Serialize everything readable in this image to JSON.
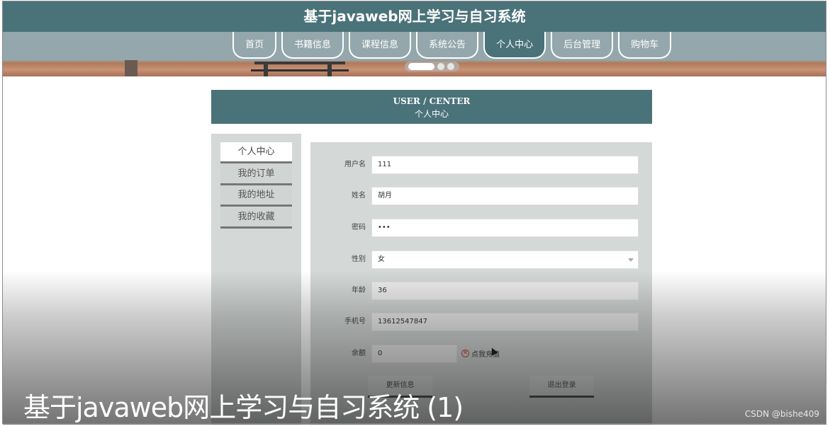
{
  "header": {
    "title": "基于javaweb网上学习与自习系统"
  },
  "nav": {
    "items": [
      {
        "label": "首页"
      },
      {
        "label": "书籍信息"
      },
      {
        "label": "课程信息"
      },
      {
        "label": "系统公告"
      },
      {
        "label": "个人中心",
        "active": true
      },
      {
        "label": "后台管理"
      },
      {
        "label": "购物车"
      }
    ]
  },
  "carousel": {
    "slide_count": 3,
    "active_index": 0
  },
  "section": {
    "title_en": "USER / CENTER",
    "title_zh": "个人中心"
  },
  "sidebar": {
    "items": [
      {
        "label": "个人中心",
        "active": true
      },
      {
        "label": "我的订单"
      },
      {
        "label": "我的地址"
      },
      {
        "label": "我的收藏"
      }
    ]
  },
  "form": {
    "username": {
      "label": "用户名",
      "value": "111"
    },
    "name": {
      "label": "姓名",
      "value": "胡月"
    },
    "password": {
      "label": "密码",
      "value": "•••"
    },
    "gender": {
      "label": "性别",
      "value": "女"
    },
    "age": {
      "label": "年龄",
      "value": "36"
    },
    "phone": {
      "label": "手机号",
      "value": "13612547847"
    },
    "balance": {
      "label": "余额",
      "value": "0",
      "recharge_label": "点我充值"
    },
    "update_button": "更新信息",
    "logout_button": "退出登录"
  },
  "overlay": {
    "caption": "基于javaweb网上学习与自习系统 (1)",
    "watermark": "CSDN @bishe409"
  },
  "colors": {
    "primary": "#4a7279",
    "panel": "#d4d8d7"
  }
}
